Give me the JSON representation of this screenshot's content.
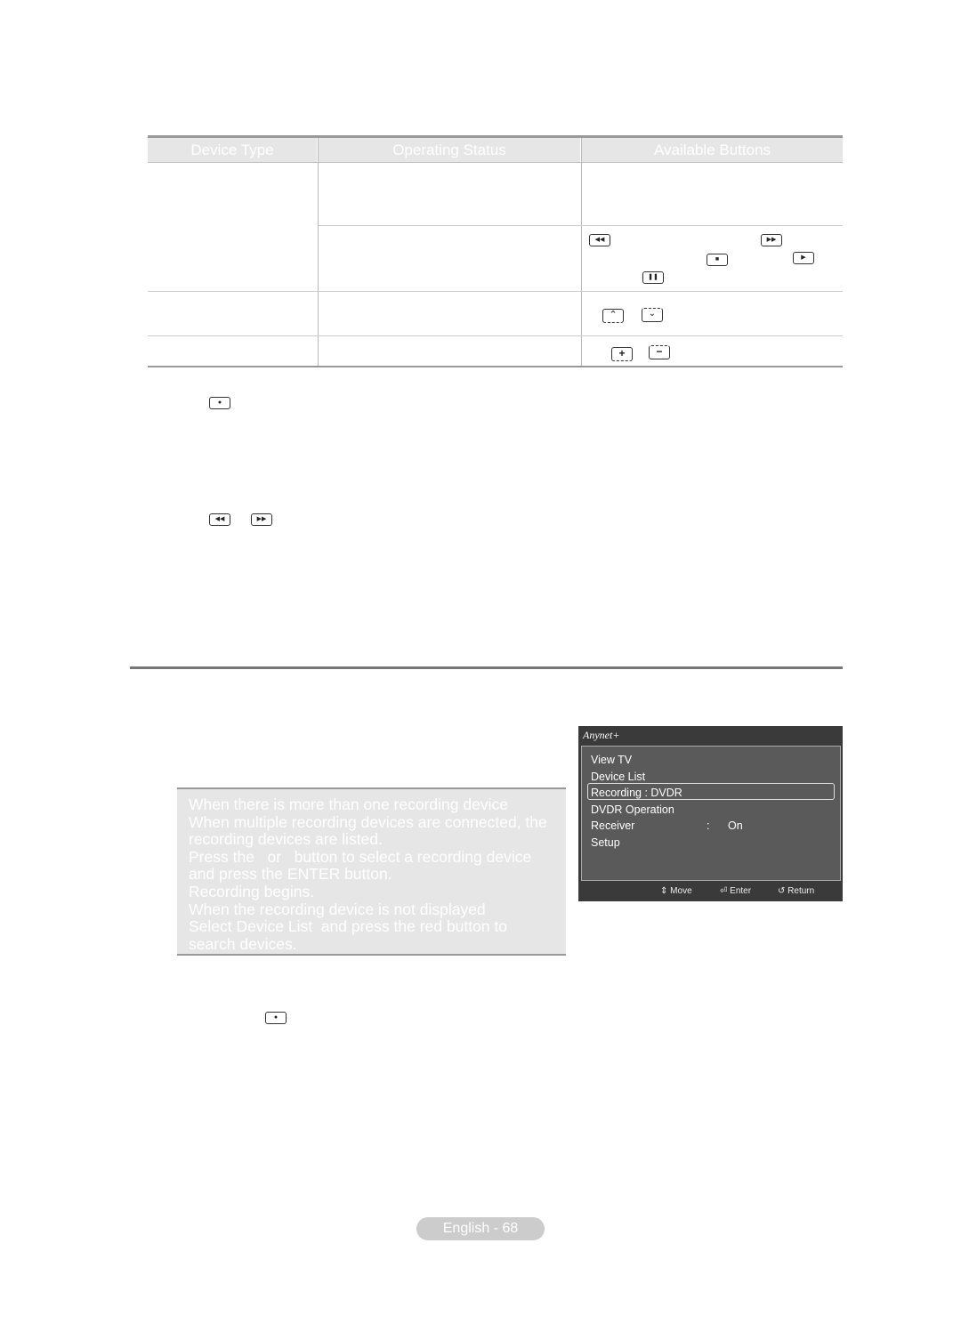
{
  "table": {
    "headers": [
      "Device Type",
      "Operating Status",
      "Available Buttons"
    ],
    "buttons": {
      "rewind": "rewind-icon",
      "fast_forward": "fast-forward-icon",
      "stop": "stop-icon",
      "play": "play-icon",
      "pause": "pause-icon",
      "channel_up": "channel-up-icon",
      "channel_down": "channel-down-icon",
      "volume_up": "volume-up-icon",
      "volume_down": "volume-down-icon"
    }
  },
  "note": {
    "lines": [
      "When there is more than one recording device",
      "When multiple recording devices are connected, the",
      "recording devices are listed.",
      "Press the   or   button to select a recording device",
      "and press the ENTER button.",
      "Recording begins.",
      "When the recording device is not displayed",
      "Select Device List  and press the red button to",
      "search devices."
    ]
  },
  "menu": {
    "logo": "Anynet+",
    "items": [
      "View TV",
      "Device List",
      "Recording : DVDR",
      "DVDR Operation",
      "Receiver",
      "Setup"
    ],
    "selected": "Recording : DVDR",
    "receiver_sep": ":",
    "receiver_value": "On",
    "footer": {
      "move": "Move",
      "enter": "Enter",
      "return": "Return"
    }
  },
  "footer": {
    "page_label": "English - 68"
  }
}
